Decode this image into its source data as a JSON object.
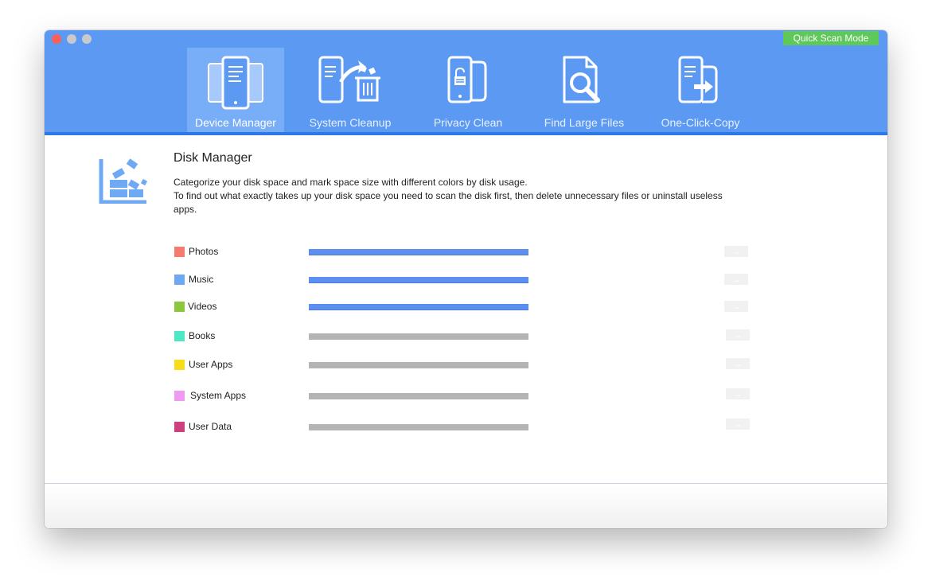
{
  "window": {
    "traffic_lights": [
      "close",
      "minimize",
      "maximize"
    ],
    "quick_scan_label": "Quick Scan Mode"
  },
  "colors": {
    "toolbar": "#5c99f2",
    "toolbar_active": "#78aef7",
    "toolbar_border": "#2e79e8",
    "quick_scan": "#5fc85a",
    "scanned_bar": "#5c8ff0",
    "pending_bar": "#b4b4b4"
  },
  "tabs": [
    {
      "label": "Device Manager",
      "icon": "phone-tablet-icon",
      "active": true
    },
    {
      "label": "System Cleanup",
      "icon": "phone-trash-icon",
      "active": false
    },
    {
      "label": "Privacy Clean",
      "icon": "phone-lock-icon",
      "active": false
    },
    {
      "label": "Find Large Files",
      "icon": "file-search-icon",
      "active": false
    },
    {
      "label": "One-Click-Copy",
      "icon": "phone-copy-icon",
      "active": false
    }
  ],
  "main": {
    "icon": "disk-manager-icon",
    "title": "Disk Manager",
    "description_line1": "Categorize your disk space and mark space size with different colors by disk usage.",
    "description_line2": "To find out what exactly takes up your disk space you need to scan the disk first, then delete unnecessary files or uninstall useless apps."
  },
  "categories": [
    {
      "label": "Photos",
      "color": "#f47b6e",
      "scanned": true
    },
    {
      "label": "Music",
      "color": "#6ea8f2",
      "scanned": true
    },
    {
      "label": "Videos",
      "color": "#8cc63f",
      "scanned": true
    },
    {
      "label": "Books",
      "color": "#4de8c4",
      "scanned": false
    },
    {
      "label": "User Apps",
      "color": "#f8dc1c",
      "scanned": false
    },
    {
      "label": "System Apps",
      "color": "#ee9cf0",
      "scanned": false
    },
    {
      "label": "User Data",
      "color": "#cf3f7e",
      "scanned": false
    }
  ],
  "row_action_icon": "arrow-right-icon"
}
